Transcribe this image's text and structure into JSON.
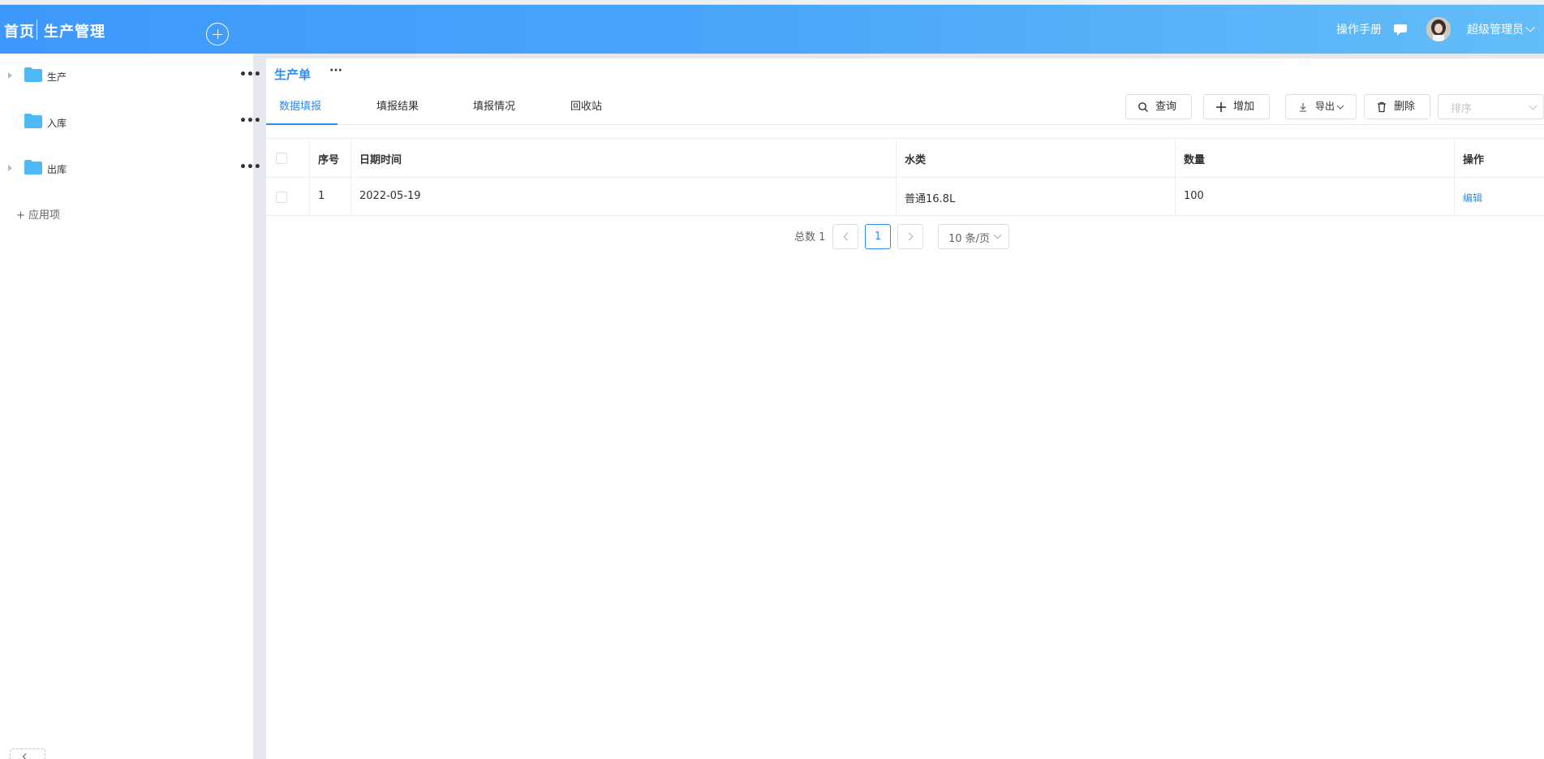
{
  "header": {
    "home": "首页",
    "app_title": "生产管理",
    "manual": "操作手册",
    "user": "超级管理员"
  },
  "sidebar": {
    "items": [
      {
        "label": "生产",
        "has_children": true
      },
      {
        "label": "入库",
        "has_children": false
      },
      {
        "label": "出库",
        "has_children": true
      }
    ],
    "more": "•••",
    "add_app": "+ 应用项"
  },
  "form": {
    "title": "生产单",
    "more": "···"
  },
  "tabs": [
    {
      "label": "数据填报",
      "active": true
    },
    {
      "label": "填报结果",
      "active": false
    },
    {
      "label": "填报情况",
      "active": false
    },
    {
      "label": "回收站",
      "active": false
    }
  ],
  "toolbar": {
    "query": "查询",
    "add": "增加",
    "export": "导出",
    "delete": "删除",
    "sort_placeholder": "排序"
  },
  "table": {
    "columns": [
      "序号",
      "日期时间",
      "水类",
      "数量",
      "操作"
    ],
    "rows": [
      {
        "index": "1",
        "datetime": "2022-05-19",
        "water_type": "普通16.8L",
        "quantity": "100",
        "action": "编辑"
      }
    ]
  },
  "pagination": {
    "total": "总数 1",
    "current_page": "1",
    "page_size": "10 条/页"
  },
  "colors": {
    "accent": "#2d8cf0",
    "header_start": "#3d98fb",
    "header_end": "#63bdf8",
    "folder": "#4cb8f5"
  }
}
